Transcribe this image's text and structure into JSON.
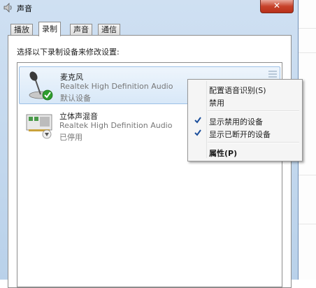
{
  "window": {
    "title": "声音",
    "close_glyph": "✕"
  },
  "tabs": [
    {
      "label": "播放",
      "active": false
    },
    {
      "label": "录制",
      "active": true
    },
    {
      "label": "声音",
      "active": false
    },
    {
      "label": "通信",
      "active": false
    }
  ],
  "panel": {
    "instruction": "选择以下录制设备来修改设置:"
  },
  "devices": [
    {
      "name": "麦克风",
      "description": "Realtek High Definition Audio",
      "status": "默认设备",
      "icon": "microphone-icon",
      "badge": "default-checkmark-icon",
      "selected": true
    },
    {
      "name": "立体声混音",
      "description": "Realtek High Definition Audio",
      "status": "已停用",
      "icon": "sound-card-icon",
      "badge": "disabled-arrow-icon",
      "selected": false
    }
  ],
  "context_menu": {
    "items": [
      {
        "label": "配置语音识别(S)",
        "checked": false,
        "bold": false
      },
      {
        "label": "禁用",
        "checked": false,
        "bold": false
      },
      {
        "label": "显示禁用的设备",
        "checked": true,
        "bold": false
      },
      {
        "label": "显示已断开的设备",
        "checked": true,
        "bold": false
      },
      {
        "label": "属性(P)",
        "checked": false,
        "bold": true
      }
    ]
  },
  "colors": {
    "check_mark": "#1c4f9c",
    "default_badge": "#2e9d2e"
  }
}
